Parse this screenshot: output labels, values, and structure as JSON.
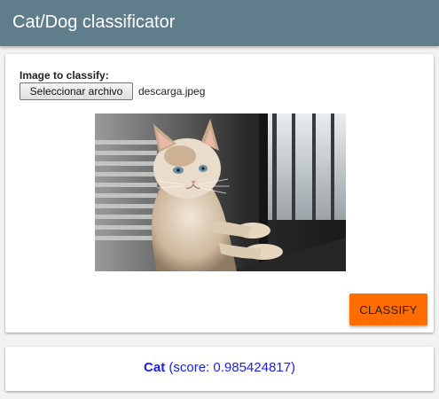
{
  "header": {
    "title": "Cat/Dog classificator"
  },
  "form": {
    "label": "Image to classify:",
    "file_button_label": "Seleccionar archivo",
    "file_name": "descarga.jpeg",
    "image_description": "photo-cat-at-window",
    "classify_label": "CLASSIFY"
  },
  "result": {
    "label": "Cat",
    "score_text": " (score: 0.985424817)"
  },
  "colors": {
    "appbar": "#607d8b",
    "accent_button": "#ff6d00",
    "result_text": "#1a1aff"
  }
}
